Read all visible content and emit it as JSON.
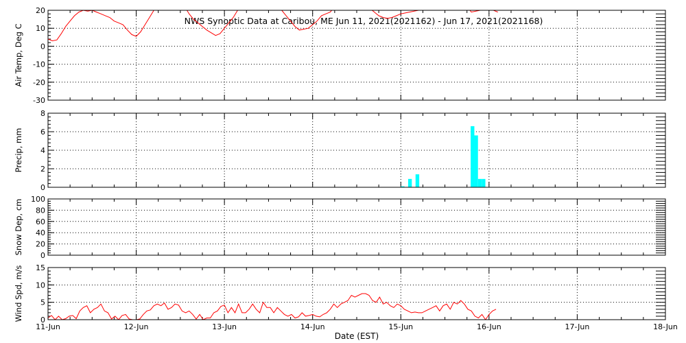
{
  "title": "NWS Synoptic Data at Caribou, ME   Jun 11, 2021(2021162) - Jun 17, 2021(2021168)",
  "xlabel": "Date (EST)",
  "x_ticks": [
    "11-Jun",
    "12-Jun",
    "13-Jun",
    "14-Jun",
    "15-Jun",
    "16-Jun",
    "17-Jun",
    "18-Jun"
  ],
  "colors": {
    "line": "#ff0000",
    "bar": "#00ffff",
    "axes": "#000000",
    "grid": "#000000"
  },
  "chart_data": [
    {
      "type": "line",
      "ylabel": "Air Temp, Deg C",
      "ylim": [
        -30,
        20
      ],
      "yticks": [
        -30,
        -20,
        -10,
        0,
        10,
        20
      ],
      "grid": true,
      "x_unit": "days since 11-Jun 00:00",
      "series": [
        {
          "x": [
            0.0,
            0.05,
            0.1,
            0.15,
            0.2,
            0.25,
            0.3,
            0.35,
            0.4,
            0.45,
            0.5,
            0.55,
            0.6,
            0.65,
            0.7,
            0.75,
            0.8,
            0.85,
            0.9,
            0.95,
            1.0,
            1.05,
            1.1,
            1.15,
            1.2,
            1.25,
            1.3,
            1.35,
            1.4,
            1.45,
            1.5,
            1.55,
            1.6,
            1.65,
            1.7,
            1.75,
            1.8,
            1.85,
            1.9,
            1.95,
            2.0,
            2.05,
            2.1,
            2.15,
            2.2,
            2.25,
            2.3,
            2.35,
            2.4,
            2.45,
            2.5,
            2.55,
            2.6,
            2.65,
            2.7,
            2.75,
            2.8,
            2.85,
            2.9,
            2.95,
            3.0,
            3.05,
            3.1,
            3.15,
            3.2,
            3.25,
            3.3,
            3.35,
            3.4,
            3.45,
            3.5,
            3.55,
            3.6,
            3.65,
            3.7,
            3.75,
            3.8,
            3.85,
            3.9,
            3.95,
            4.0,
            4.05,
            4.1,
            4.15,
            4.2,
            4.25,
            4.3,
            4.35,
            4.4,
            4.45,
            4.5,
            4.55,
            4.6,
            4.65,
            4.7,
            4.75,
            4.8,
            4.85,
            4.9,
            4.95,
            5.0,
            5.05,
            5.1
          ],
          "y": [
            4,
            3,
            3.5,
            7,
            11,
            14,
            17,
            19,
            20,
            19.5,
            20,
            19,
            18,
            17,
            16,
            14,
            13,
            12,
            9,
            6.5,
            5.5,
            8,
            12,
            16,
            20,
            22,
            22,
            22,
            22,
            22,
            22,
            22,
            18,
            15,
            13,
            11,
            9,
            7.5,
            6,
            7,
            10,
            13,
            16,
            20,
            22,
            22,
            22,
            22,
            22,
            22,
            22,
            22,
            22,
            20,
            17,
            14,
            11,
            9,
            9.5,
            10,
            12,
            14,
            17,
            18,
            19,
            22,
            22,
            22,
            22,
            22,
            22,
            22,
            22,
            21,
            19,
            17,
            16,
            15.5,
            16,
            17,
            18,
            18.5,
            19,
            19.5,
            20,
            21,
            22,
            22,
            22,
            22,
            22,
            22,
            22,
            22,
            22,
            22,
            19,
            19.5,
            20,
            20.5,
            21,
            20,
            19
          ]
        }
      ]
    },
    {
      "type": "bar",
      "ylabel": "Precip, mm",
      "ylim": [
        0,
        8
      ],
      "yticks": [
        0,
        2,
        4,
        6,
        8
      ],
      "grid": true,
      "x_unit": "days since 11-Jun 00:00 (bar start)",
      "bar_width_days": 0.0417,
      "x": [
        4.0,
        4.083,
        4.167,
        4.792,
        4.833,
        4.875,
        4.917
      ],
      "values": [
        0.1,
        0.9,
        1.4,
        6.6,
        5.6,
        0.9,
        0.9
      ]
    },
    {
      "type": "line",
      "ylabel": "Snow Dep, cm",
      "ylim": [
        0,
        100
      ],
      "yticks": [
        0,
        20,
        40,
        60,
        80,
        100
      ],
      "grid": true,
      "series": []
    },
    {
      "type": "line",
      "ylabel": "Wind Spd, m/s",
      "ylim": [
        0,
        15
      ],
      "yticks": [
        0,
        5,
        10,
        15
      ],
      "grid": true,
      "x_unit": "days since 11-Jun 00:00",
      "series": [
        {
          "x": [
            0.0,
            0.04,
            0.08,
            0.12,
            0.16,
            0.2,
            0.24,
            0.28,
            0.32,
            0.36,
            0.4,
            0.44,
            0.48,
            0.52,
            0.56,
            0.6,
            0.64,
            0.68,
            0.72,
            0.76,
            0.8,
            0.84,
            0.88,
            0.92,
            0.96,
            1.0,
            1.04,
            1.08,
            1.12,
            1.16,
            1.2,
            1.24,
            1.28,
            1.32,
            1.36,
            1.4,
            1.44,
            1.48,
            1.52,
            1.56,
            1.6,
            1.64,
            1.68,
            1.72,
            1.76,
            1.8,
            1.84,
            1.88,
            1.92,
            1.96,
            2.0,
            2.04,
            2.08,
            2.12,
            2.16,
            2.2,
            2.24,
            2.28,
            2.32,
            2.36,
            2.4,
            2.44,
            2.48,
            2.52,
            2.56,
            2.6,
            2.64,
            2.68,
            2.72,
            2.76,
            2.8,
            2.84,
            2.88,
            2.92,
            2.96,
            3.0,
            3.04,
            3.08,
            3.12,
            3.16,
            3.2,
            3.24,
            3.28,
            3.32,
            3.36,
            3.4,
            3.44,
            3.48,
            3.52,
            3.56,
            3.6,
            3.64,
            3.68,
            3.72,
            3.76,
            3.8,
            3.84,
            3.88,
            3.92,
            3.96,
            4.0,
            4.04,
            4.08,
            4.12,
            4.16,
            4.2,
            4.24,
            4.28,
            4.32,
            4.36,
            4.4,
            4.44,
            4.48,
            4.52,
            4.56,
            4.6,
            4.64,
            4.68,
            4.72,
            4.76,
            4.8,
            4.84,
            4.88,
            4.92,
            4.96,
            5.0,
            5.04,
            5.08
          ],
          "y": [
            0.5,
            1.2,
            0,
            1.0,
            0,
            0.3,
            1.0,
            1.2,
            0.3,
            2.5,
            3.5,
            4.0,
            2.0,
            3.0,
            3.5,
            4.5,
            2.5,
            2.0,
            0.2,
            1.0,
            0,
            1.2,
            1.5,
            0.2,
            0,
            0,
            0.2,
            1.5,
            2.5,
            2.8,
            4.0,
            4.5,
            4.0,
            4.8,
            3.0,
            3.5,
            4.5,
            4.2,
            2.5,
            2.0,
            2.5,
            1.5,
            0.2,
            1.5,
            0,
            0.5,
            0.5,
            2.0,
            2.5,
            3.8,
            4.2,
            2.0,
            3.5,
            2.0,
            4.5,
            2.0,
            2.0,
            3.0,
            4.5,
            3.0,
            2.0,
            5.0,
            3.5,
            3.5,
            2.0,
            3.5,
            2.5,
            1.5,
            1.0,
            1.5,
            0.5,
            0.8,
            2.0,
            1.0,
            1.2,
            1.5,
            1.0,
            0.8,
            1.5,
            2.0,
            3.0,
            4.5,
            3.5,
            4.5,
            5.0,
            5.5,
            7.0,
            6.5,
            7.0,
            7.5,
            7.5,
            7.0,
            5.5,
            5.0,
            6.5,
            4.5,
            5.0,
            4.0,
            3.5,
            4.5,
            4.0,
            3.0,
            2.5,
            2.0,
            2.2,
            2.0,
            2.0,
            2.5,
            3.0,
            3.5,
            4.0,
            2.5,
            4.0,
            4.5,
            3.0,
            5.0,
            4.5,
            5.5,
            4.5,
            3.0,
            2.5,
            1.0,
            0.5,
            1.5,
            0,
            1.5,
            2.5,
            3.0
          ]
        }
      ]
    }
  ]
}
